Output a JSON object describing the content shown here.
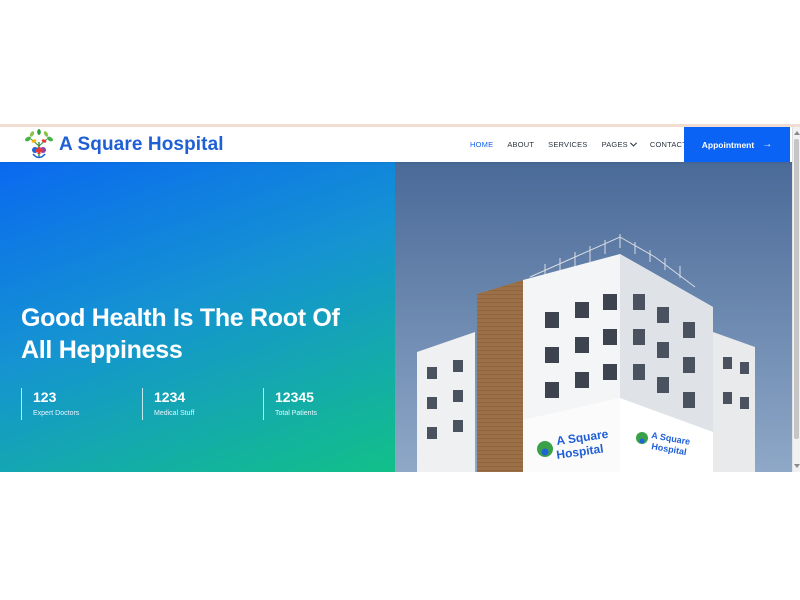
{
  "header": {
    "brand_name": "A Square Hospital",
    "logo_icon": "tree-medical-logo-icon",
    "nav": [
      {
        "label": "HOME",
        "active": true
      },
      {
        "label": "ABOUT",
        "active": false
      },
      {
        "label": "SERVICES",
        "active": false
      },
      {
        "label": "PAGES",
        "active": false,
        "has_dropdown": true
      },
      {
        "label": "CONTACT",
        "active": false
      }
    ],
    "cta_label": "Appointment",
    "cta_icon": "arrow-right-icon"
  },
  "hero": {
    "title_line1": "Good Health Is The Root Of",
    "title_line2": "All Heppiness",
    "stats": [
      {
        "value": "123",
        "label": "Expert Doctors"
      },
      {
        "value": "1234",
        "label": "Medical Stuff"
      },
      {
        "value": "12345",
        "label": "Total Patients"
      }
    ],
    "image": {
      "subject": "hospital-building-photo",
      "sign_line1": "A Square",
      "sign_line2": "Hospital"
    }
  },
  "colors": {
    "brand_blue": "#1f5fd6",
    "accent_blue": "#0b63f6",
    "gradient_start": "#0a69f0",
    "gradient_end": "#12c088"
  }
}
